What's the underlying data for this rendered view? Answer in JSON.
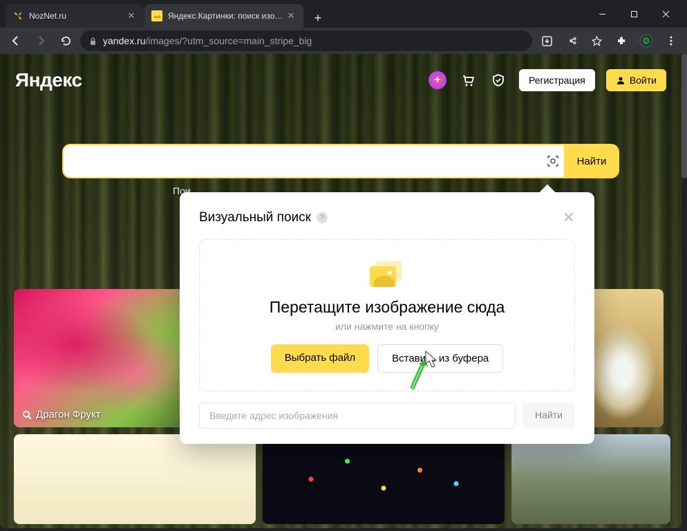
{
  "browser": {
    "tabs": [
      {
        "title": "NozNet.ru"
      },
      {
        "title": "Яндекс.Картинки: поиск изобра"
      }
    ],
    "url_domain": "yandex.ru",
    "url_path": "/images/?utm_source=main_stripe_big"
  },
  "header": {
    "logo": "Яндекс",
    "register": "Регистрация",
    "login": "Войти"
  },
  "search": {
    "button": "Найти",
    "category_prefix": "Пои"
  },
  "thumbnail": {
    "label1": "Драгон Фрукт"
  },
  "popup": {
    "title": "Визуальный поиск",
    "dz_title": "Перетащите изображение сюда",
    "dz_sub": "или нажмите на кнопку",
    "btn_choose": "Выбрать файл",
    "btn_paste": "Вставить из буфера",
    "url_placeholder": "Введите адрес изображения",
    "url_btn": "Найти"
  }
}
